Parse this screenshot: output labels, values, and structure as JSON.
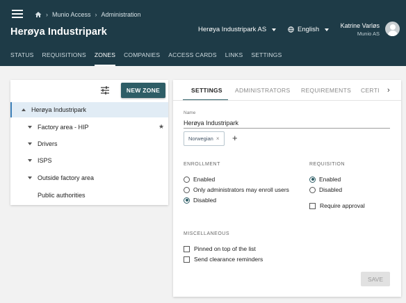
{
  "breadcrumb": {
    "app": "Munio Access",
    "page": "Administration"
  },
  "header": {
    "title": "Herøya Industripark",
    "org_select": "Herøya Industripark AS",
    "language": "English",
    "user_name": "Katrine Varløs",
    "user_org": "Munio AS"
  },
  "nav": [
    "STATUS",
    "REQUISITIONS",
    "ZONES",
    "COMPANIES",
    "ACCESS CARDS",
    "LINKS",
    "SETTINGS"
  ],
  "nav_active": "ZONES",
  "left": {
    "new_zone_label": "NEW ZONE",
    "root": "Herøya Industripark",
    "items": [
      "Factory area - HIP",
      "Drivers",
      "ISPS",
      "Outside factory area",
      "Public authorities"
    ]
  },
  "tabs": [
    "SETTINGS",
    "ADMINISTRATORS",
    "REQUIREMENTS",
    "CERTI"
  ],
  "form": {
    "name_label": "Name",
    "name_value": "Herøya Industripark",
    "chip": "Norwegian",
    "enrollment_title": "ENROLLMENT",
    "enrollment_options": [
      "Enabled",
      "Only administrators may enroll users",
      "Disabled"
    ],
    "enrollment_selected": "Disabled",
    "requisition_title": "REQUISITION",
    "requisition_options": [
      "Enabled",
      "Disabled"
    ],
    "requisition_selected": "Enabled",
    "require_approval": "Require approval",
    "misc_title": "MISCELLANEOUS",
    "misc_options": [
      "Pinned on top of the list",
      "Send clearance reminders"
    ],
    "save_label": "SAVE"
  },
  "colors": {
    "header_bg": "#1e3b47",
    "accent": "#2e5d66",
    "selected_row": "#e1ecf5"
  }
}
